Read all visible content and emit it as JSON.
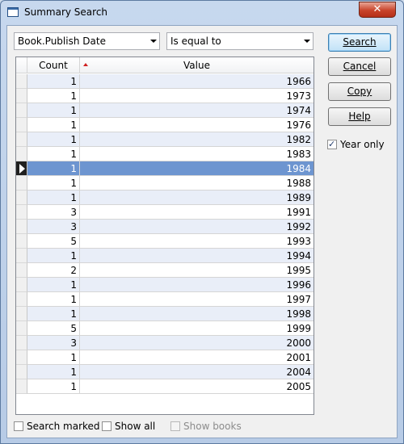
{
  "window": {
    "title": "Summary Search",
    "close_glyph": "✕"
  },
  "field_select": {
    "value": "Book.Publish Date"
  },
  "operator_select": {
    "value": "Is equal to"
  },
  "grid": {
    "columns": [
      "Count",
      "Value"
    ],
    "selected_index": 6,
    "rows": [
      {
        "count": "1",
        "value": "1966"
      },
      {
        "count": "1",
        "value": "1973"
      },
      {
        "count": "1",
        "value": "1974"
      },
      {
        "count": "1",
        "value": "1976"
      },
      {
        "count": "1",
        "value": "1982"
      },
      {
        "count": "1",
        "value": "1983"
      },
      {
        "count": "1",
        "value": "1984"
      },
      {
        "count": "1",
        "value": "1988"
      },
      {
        "count": "1",
        "value": "1989"
      },
      {
        "count": "3",
        "value": "1991"
      },
      {
        "count": "3",
        "value": "1992"
      },
      {
        "count": "5",
        "value": "1993"
      },
      {
        "count": "1",
        "value": "1994"
      },
      {
        "count": "2",
        "value": "1995"
      },
      {
        "count": "1",
        "value": "1996"
      },
      {
        "count": "1",
        "value": "1997"
      },
      {
        "count": "1",
        "value": "1998"
      },
      {
        "count": "5",
        "value": "1999"
      },
      {
        "count": "3",
        "value": "2000"
      },
      {
        "count": "1",
        "value": "2001"
      },
      {
        "count": "1",
        "value": "2004"
      },
      {
        "count": "1",
        "value": "2005"
      }
    ]
  },
  "buttons": {
    "search": "Search",
    "cancel": "Cancel",
    "copy": "Copy",
    "help": "Help"
  },
  "options": {
    "year_only": {
      "label": "Year only",
      "checked": true
    },
    "search_marked": {
      "label": "Search marked",
      "checked": false
    },
    "show_all": {
      "label": "Show all",
      "checked": false
    },
    "show_books": {
      "label": "Show books",
      "checked": false,
      "disabled": true
    }
  },
  "colors": {
    "selection": "#6d95d0",
    "alt_row": "#e9eef8",
    "sort_indicator": "#d02020"
  }
}
